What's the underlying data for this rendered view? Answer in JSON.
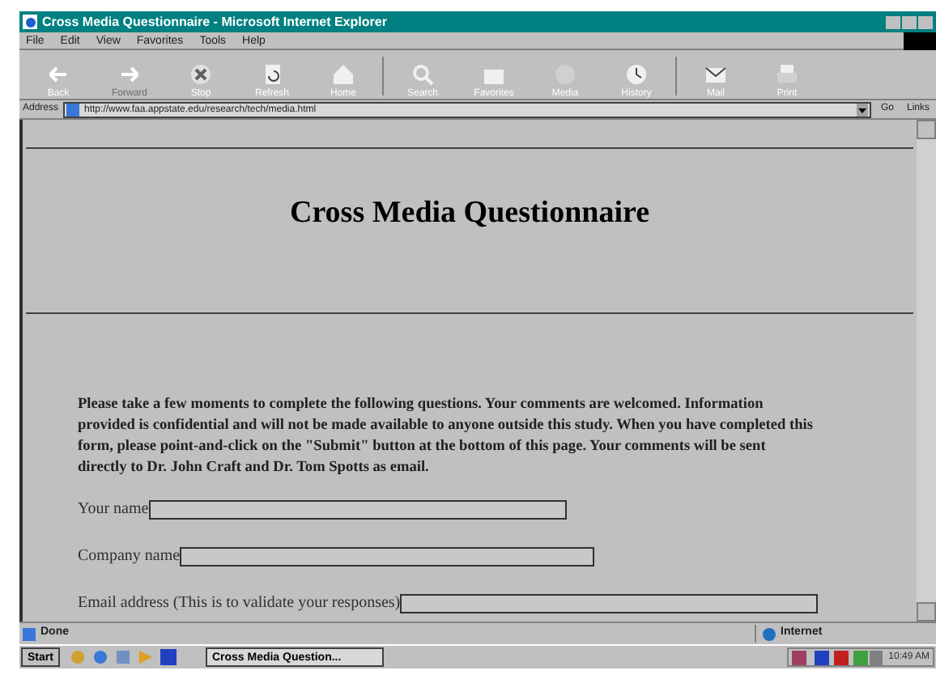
{
  "window": {
    "title": "Cross Media Questionnaire - Microsoft Internet Explorer"
  },
  "menu": [
    "File",
    "Edit",
    "View",
    "Favorites",
    "Tools",
    "Help"
  ],
  "toolbar": [
    {
      "label": "Back",
      "kind": "back",
      "disabled": false
    },
    {
      "label": "Forward",
      "kind": "forward",
      "disabled": true
    },
    {
      "label": "Stop",
      "kind": "stop",
      "disabled": false
    },
    {
      "label": "Refresh",
      "kind": "refresh",
      "disabled": false
    },
    {
      "label": "Home",
      "kind": "home",
      "disabled": false
    },
    {
      "label": "Search",
      "kind": "search",
      "disabled": false
    },
    {
      "label": "Favorites",
      "kind": "favorites",
      "disabled": false
    },
    {
      "label": "Media",
      "kind": "media",
      "disabled": false
    },
    {
      "label": "History",
      "kind": "history",
      "disabled": false
    },
    {
      "label": "Mail",
      "kind": "mail",
      "disabled": false
    },
    {
      "label": "Print",
      "kind": "print",
      "disabled": false
    }
  ],
  "address_bar": {
    "label": "Address",
    "url": "http://www.faa.appstate.edu/research/tech/media.html",
    "go": "Go",
    "links": "Links"
  },
  "page": {
    "heading": "Cross Media Questionnaire",
    "intro": "Please take a few moments to complete the following questions. Your comments are welcomed. Information provided is confidential and will not be made available to anyone outside this study. When you have completed this form, please point-and-click on the \"Submit\" button at the bottom of this page. Your comments will be sent directly to Dr. John Craft and Dr. Tom Spotts as email.",
    "fields": [
      {
        "label": "Your name"
      },
      {
        "label": "Company name"
      },
      {
        "label": "Email address (This is to validate your responses)"
      }
    ]
  },
  "status_bar": {
    "text": "Done",
    "zone": "Internet"
  },
  "taskbar": {
    "start": "Start",
    "task": "Cross Media Question...",
    "clock": "10:49 AM"
  }
}
